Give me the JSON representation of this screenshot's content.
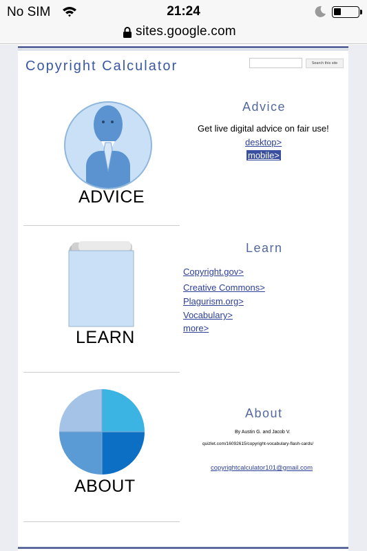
{
  "status_bar": {
    "carrier": "No SIM",
    "time": "21:24"
  },
  "browser": {
    "url": "sites.google.com"
  },
  "header": {
    "site_title": "Copyright Calculator",
    "search_button": "Search this site"
  },
  "advice": {
    "image_caption": "ADVICE",
    "heading": "Advice",
    "description": "Get live digital advice on fair use!",
    "links": [
      "desktop>",
      "mobile>"
    ]
  },
  "learn": {
    "image_caption": "LEARN",
    "heading": "Learn",
    "links": [
      "Copyright.gov>",
      "Creative Commons>",
      "Plagurism.org>",
      "Vocabulary>",
      "more>"
    ]
  },
  "about": {
    "image_caption": "ABOUT",
    "heading": "About",
    "authors": "By Austin G. and Jacob V.",
    "quizlet": "quizlet.com/16092615/copyright-vocabulary-flash-cards/",
    "email": "copyrightcalculator101@gmail.com"
  },
  "colors": {
    "title_blue": "#3a57a2",
    "heading_blue": "#53689e",
    "link_blue": "#2b3e98",
    "selection": "#3a4fa0",
    "pie_light": "#a4c3e6",
    "pie_cyan": "#3cb4e3",
    "pie_mid": "#5a9bd5",
    "pie_dark": "#0c6fc3"
  }
}
